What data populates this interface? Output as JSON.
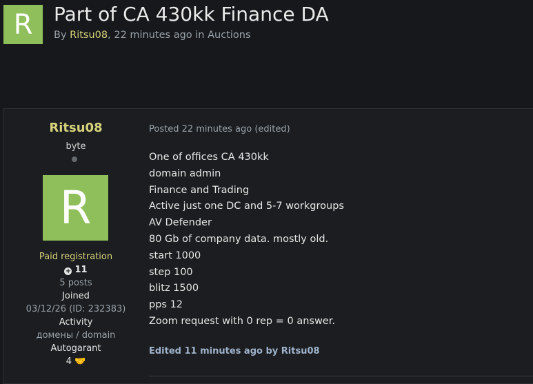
{
  "topic": {
    "avatar_letter": "R",
    "title": "Part of CA 430kk Finance DA",
    "by": "By ",
    "author": "Ritsu08",
    "time": ", 22 minutes ago in ",
    "forum": "Auctions"
  },
  "author": {
    "name": "Ritsu08",
    "title": "byte",
    "avatar_letter": "R",
    "group": "Paid registration",
    "reputation": "11",
    "posts": "5 posts",
    "joined_label": "Joined",
    "joined_value": "03/12/26 (ID: 232383)",
    "activity_label": "Activity",
    "activity_value": "домены / domain",
    "autogarant_label": "Autogarant",
    "autogarant_value": "4"
  },
  "post": {
    "meta": "Posted 22 minutes ago (edited)",
    "lines": [
      "One of offices CA 430kk",
      "domain admin",
      "Finance and Trading",
      "Active just one DC and 5-7 workgroups",
      "AV Defender",
      "80 Gb of company data. mostly old.",
      "start 1000",
      "step 100",
      "blitz 1500",
      "pps 12",
      "Zoom request with 0 rep = 0 answer."
    ],
    "edited": "Edited 11 minutes ago by Ritsu08"
  },
  "colors": {
    "accent_user": "#d7d47c",
    "avatar_bg": "#8fbf5a",
    "background": "#16181b"
  },
  "icons": {
    "reputation": "plus-circle-icon",
    "autogarant": "handshake-icon",
    "status": "offline-dot-icon"
  }
}
